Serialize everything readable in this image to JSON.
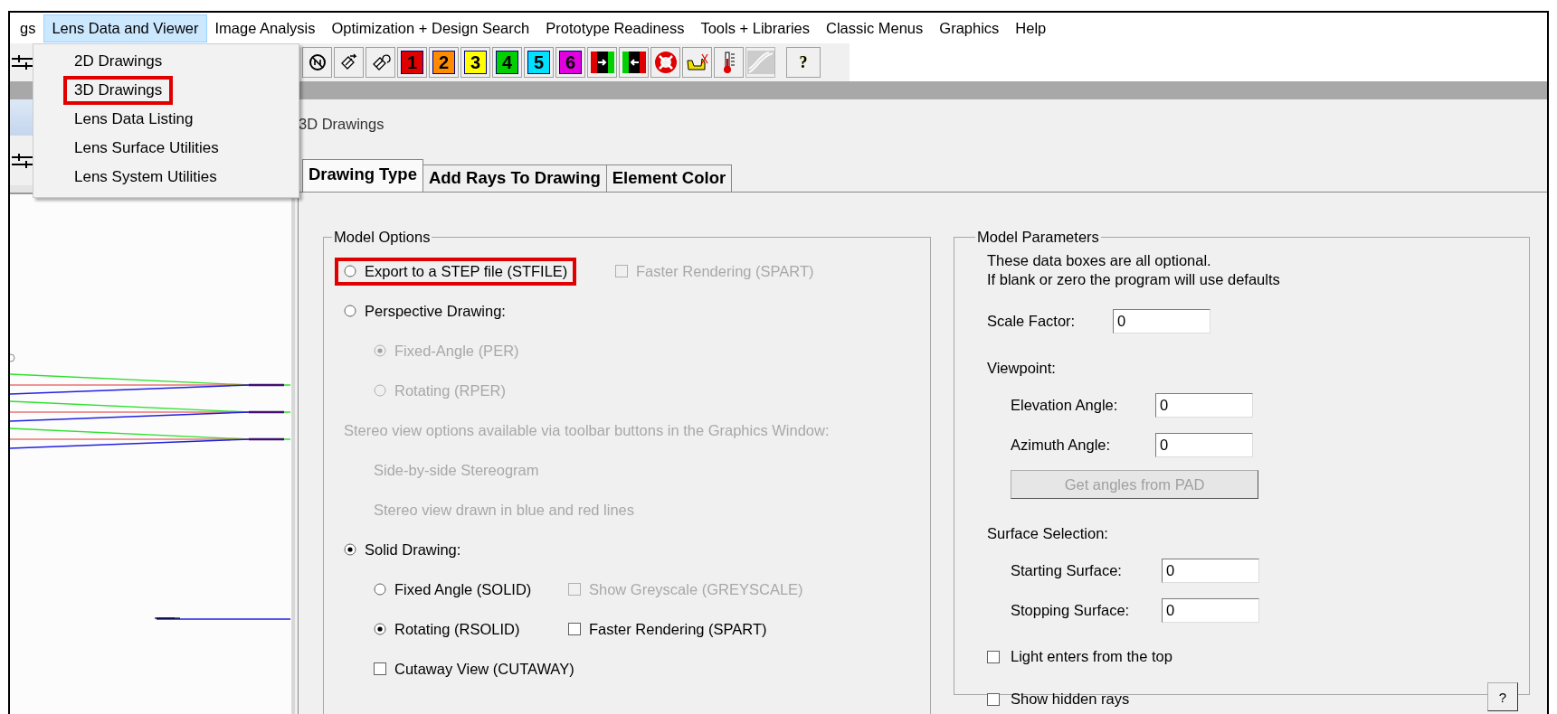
{
  "menu_bar": {
    "items": [
      {
        "label": "gs",
        "selected": false
      },
      {
        "label": "Lens Data and Viewer",
        "selected": true
      },
      {
        "label": "Image Analysis",
        "selected": false
      },
      {
        "label": "Optimization + Design Search",
        "selected": false
      },
      {
        "label": "Prototype Readiness",
        "selected": false
      },
      {
        "label": "Tools + Libraries",
        "selected": false
      },
      {
        "label": "Classic Menus",
        "selected": false
      },
      {
        "label": "Graphics",
        "selected": false
      },
      {
        "label": "Help",
        "selected": false
      }
    ]
  },
  "toolbar": {
    "buttons": [
      {
        "kind": "no-sign",
        "disabled": false
      },
      {
        "kind": "note-left",
        "disabled": false
      },
      {
        "kind": "note-undo",
        "disabled": false
      },
      {
        "kind": "number",
        "label": "1",
        "color": "#e00000",
        "disabled": false
      },
      {
        "kind": "number",
        "label": "2",
        "color": "#ff8c00",
        "disabled": false
      },
      {
        "kind": "number",
        "label": "3",
        "color": "#ffff00",
        "disabled": false
      },
      {
        "kind": "number",
        "label": "4",
        "color": "#00d000",
        "disabled": false
      },
      {
        "kind": "number",
        "label": "5",
        "color": "#00e0ff",
        "disabled": false
      },
      {
        "kind": "number",
        "label": "6",
        "color": "#e000e0",
        "disabled": false
      },
      {
        "kind": "arrow-right",
        "disabled": false
      },
      {
        "kind": "arrow-left",
        "disabled": false
      },
      {
        "kind": "lifebuoy",
        "disabled": false
      },
      {
        "kind": "duck",
        "disabled": false
      },
      {
        "kind": "thermometer",
        "disabled": false
      },
      {
        "kind": "curve",
        "disabled": true
      },
      {
        "kind": "text",
        "label": "?",
        "disabled": false
      }
    ]
  },
  "dropdown": {
    "items": [
      {
        "label": "2D Drawings",
        "annotated": false
      },
      {
        "label": "3D Drawings",
        "annotated": true
      },
      {
        "label": "Lens Data Listing",
        "annotated": false
      },
      {
        "label": "Lens Surface Utilities",
        "annotated": false
      },
      {
        "label": "Lens System Utilities",
        "annotated": false
      }
    ]
  },
  "dialog": {
    "title": "3D Drawings",
    "tabs": [
      {
        "label": "Drawing Type",
        "selected": true
      },
      {
        "label": "Add Rays To Drawing",
        "selected": false
      },
      {
        "label": "Element Color",
        "selected": false
      }
    ],
    "model_options": {
      "title": "Model Options",
      "rows": [
        {
          "controls": [
            {
              "kind": "radio",
              "label": "Export to a STEP file (STFILE)",
              "selected": false,
              "disabled": false,
              "annotated": true
            },
            {
              "kind": "checkbox",
              "label": "Faster Rendering (SPART)",
              "checked": false,
              "disabled": true,
              "annotated": false
            }
          ]
        },
        {
          "controls": [
            {
              "kind": "radio",
              "label": "Perspective Drawing:",
              "selected": false,
              "disabled": false,
              "annotated": false
            }
          ],
          "children": [
            {
              "controls": [
                {
                  "kind": "radio",
                  "label": "Fixed-Angle (PER)",
                  "selected": true,
                  "disabled": true,
                  "annotated": false
                }
              ]
            },
            {
              "controls": [
                {
                  "kind": "radio",
                  "label": "Rotating (RPER)",
                  "selected": false,
                  "disabled": true,
                  "annotated": false
                }
              ]
            }
          ]
        },
        {
          "controls": [
            {
              "kind": "text",
              "label": "Stereo view options available via toolbar buttons in the Graphics Window:",
              "disabled": true
            }
          ],
          "children": [
            {
              "controls": [
                {
                  "kind": "text",
                  "label": "Side-by-side Stereogram",
                  "disabled": true
                }
              ]
            },
            {
              "controls": [
                {
                  "kind": "text",
                  "label": "Stereo view drawn in blue and red lines",
                  "disabled": true
                }
              ]
            }
          ]
        },
        {
          "controls": [
            {
              "kind": "radio",
              "label": "Solid Drawing:",
              "selected": true,
              "disabled": false,
              "annotated": false
            }
          ],
          "children": [
            {
              "controls": [
                {
                  "kind": "radio",
                  "label": "Fixed Angle (SOLID)",
                  "selected": false,
                  "disabled": false,
                  "annotated": false
                },
                {
                  "kind": "checkbox",
                  "label": "Show Greyscale (GREYSCALE)",
                  "checked": false,
                  "disabled": true,
                  "annotated": false
                }
              ]
            },
            {
              "controls": [
                {
                  "kind": "radio",
                  "label": "Rotating (RSOLID)",
                  "selected": true,
                  "disabled": false,
                  "annotated": false
                },
                {
                  "kind": "checkbox",
                  "label": "Faster Rendering (SPART)",
                  "checked": false,
                  "disabled": false,
                  "annotated": false
                }
              ]
            },
            {
              "controls": [
                {
                  "kind": "checkbox",
                  "label": "Cutaway View (CUTAWAY)",
                  "checked": false,
                  "disabled": false,
                  "annotated": false
                }
              ]
            }
          ]
        }
      ]
    },
    "model_parameters": {
      "title": "Model Parameters",
      "notes": [
        "These data boxes are all optional.",
        "If blank or zero the program will use defaults"
      ],
      "scale_field": {
        "label": "Scale Factor:",
        "value": "0"
      },
      "viewpoint": {
        "label": "Viewpoint:",
        "fields": [
          {
            "label": "Elevation Angle:",
            "value": "0"
          },
          {
            "label": "Azimuth Angle:",
            "value": "0"
          }
        ],
        "button": {
          "label": "Get angles from PAD",
          "disabled": true
        }
      },
      "surface_selection": {
        "label": "Surface Selection:",
        "fields": [
          {
            "label": "Starting Surface:",
            "value": "0"
          },
          {
            "label": "Stopping Surface:",
            "value": "0"
          }
        ]
      },
      "checkboxes": [
        {
          "label": "Light enters from the top",
          "checked": false
        },
        {
          "label": "Show hidden rays",
          "checked": false
        }
      ],
      "help_button": "?"
    }
  }
}
